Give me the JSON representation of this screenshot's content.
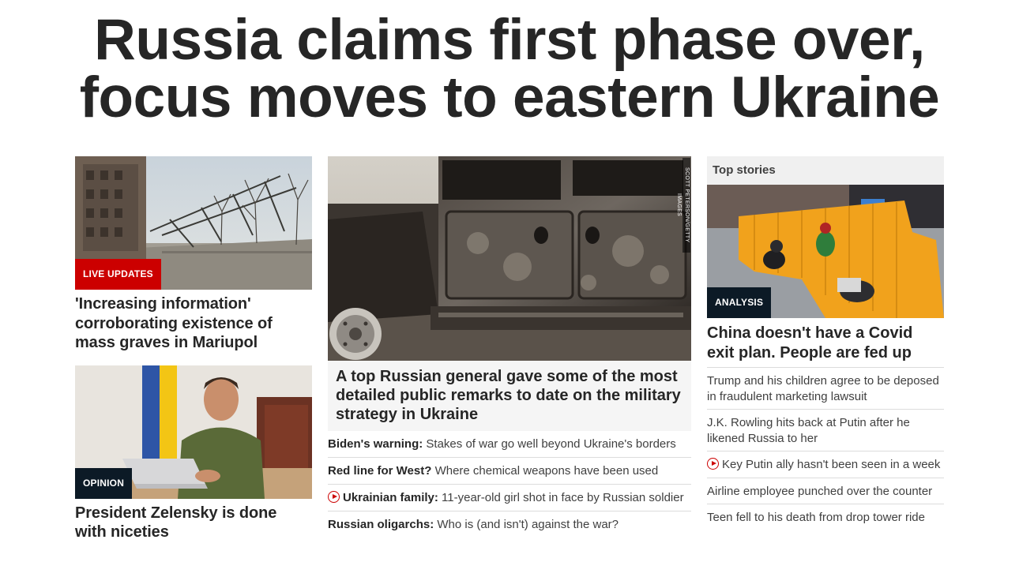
{
  "headline": {
    "line1": "Russia claims first phase over,",
    "line2": "focus moves to eastern Ukraine"
  },
  "left": {
    "story1": {
      "tag": "LIVE UPDATES",
      "title": "'Increasing information' corroborating existence of mass graves in Mariupol"
    },
    "story2": {
      "tag": "OPINION",
      "title": "President Zelensky is done with niceties"
    }
  },
  "center": {
    "image_credit": "SCOTT PETERSON/GETTY IMAGES",
    "title": "A top Russian general gave some of the most detailed public remarks to date on the military strategy in Ukraine",
    "links": [
      {
        "bold": "Biden's warning:",
        "text": " Stakes of war go well beyond Ukraine's borders",
        "video": false
      },
      {
        "bold": "Red line for West?",
        "text": " Where chemical weapons have been used",
        "video": false
      },
      {
        "bold": "Ukrainian family:",
        "text": " 11-year-old girl shot in face by Russian soldier",
        "video": true
      },
      {
        "bold": "Russian oligarchs:",
        "text": " Who is (and isn't) against the war?",
        "video": false
      }
    ]
  },
  "right": {
    "section_title": "Top stories",
    "card": {
      "tag": "ANALYSIS",
      "title": "China doesn't have a Covid exit plan. People are fed up"
    },
    "links": [
      {
        "text": "Trump and his children agree to be deposed in fraudulent marketing lawsuit",
        "video": false
      },
      {
        "text": "J.K. Rowling hits back at Putin after he likened Russia to her",
        "video": false
      },
      {
        "text": "Key Putin ally hasn't been seen in a week",
        "video": true
      },
      {
        "text": "Airline employee punched over the counter",
        "video": false
      },
      {
        "text": "Teen fell to his death from drop tower ride",
        "video": false
      }
    ]
  },
  "colors": {
    "live_red": "#cc0000",
    "tag_dark": "#0c1a26",
    "text_dark": "#262626"
  }
}
